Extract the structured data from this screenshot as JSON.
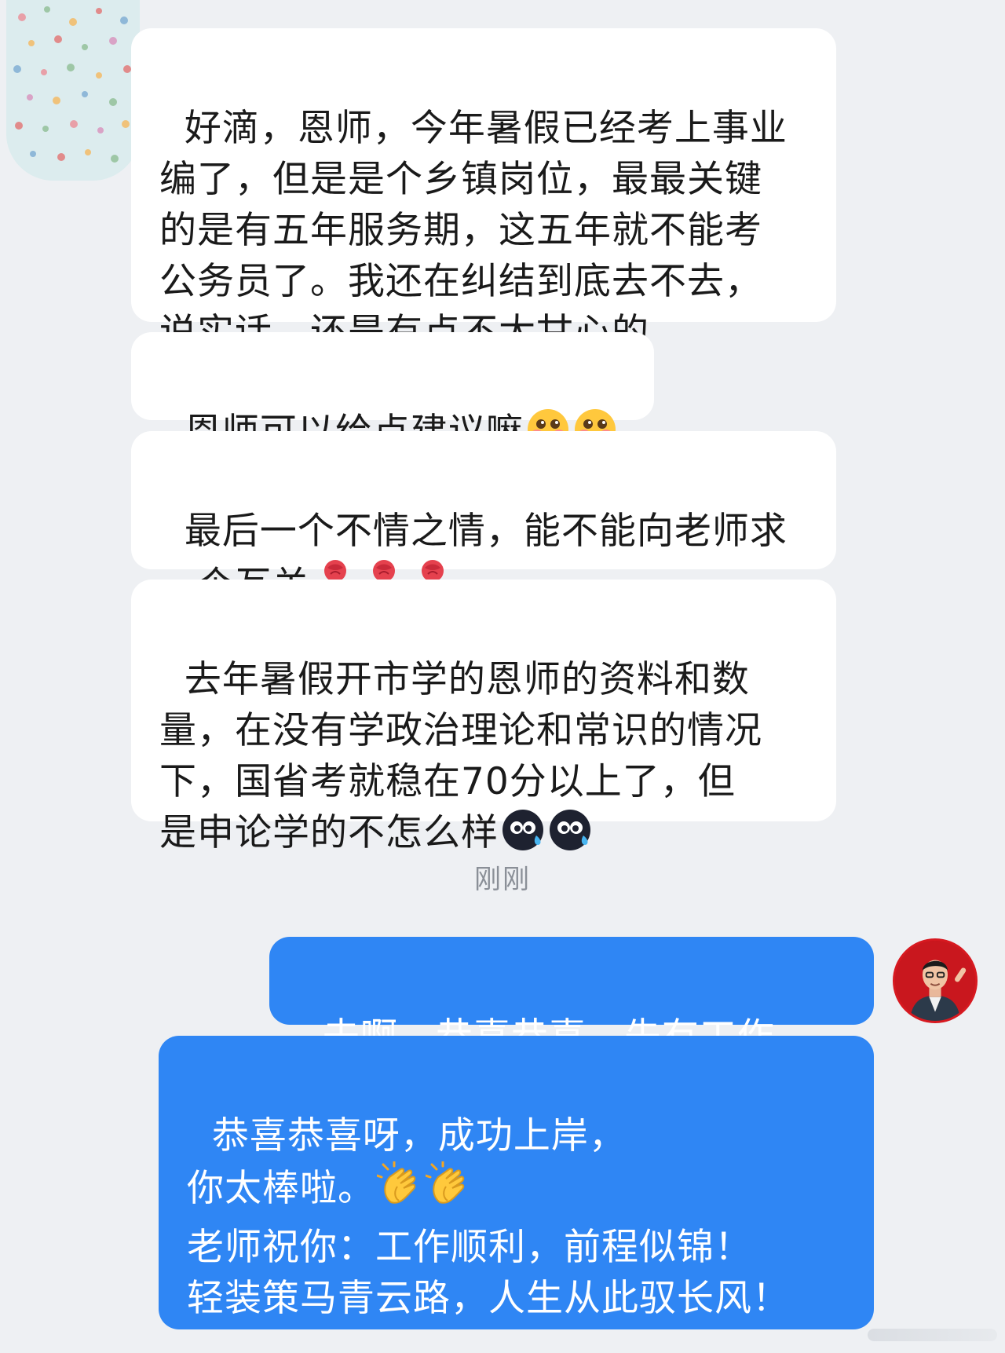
{
  "chat": {
    "incoming": [
      {
        "text": "好滴，恩师，今年暑假已经考上事业\n编了，但是是个乡镇岗位，最最关键\n的是有五年服务期，这五年就不能考\n公务员了。我还在纠结到底去不去，\n说实话，还是有点不太甘心的",
        "emojis": []
      },
      {
        "text": "恩师可以给点建议嘛",
        "emojis": [
          "blushing-heart-emoji",
          "blushing-heart-emoji"
        ]
      },
      {
        "text": "最后一个不情之情，能不能向老师求\n一个互关",
        "emojis": [
          "rose-emoji",
          "rose-emoji",
          "rose-emoji"
        ]
      },
      {
        "text": "去年暑假开市学的恩师的资料和数\n量，在没有学政治理论和常识的情况\n下，国省考就稳在70分以上了，但\n是申论学的不怎么样",
        "emojis": [
          "sweat-face-emoji",
          "sweat-face-emoji"
        ]
      }
    ],
    "timestamp": "刚刚",
    "outgoing": [
      {
        "text": "去啊，恭喜恭喜，先有工作啊。"
      },
      {
        "text_line1": "恭喜恭喜呀，成功上岸，",
        "text_line2": "你太棒啦。",
        "emojis": [
          "clapping-hands-emoji",
          "clapping-hands-emoji"
        ],
        "text_rest": "\n老师祝你：工作顺利，前程似锦！\n轻装策马青云路，人生从此驭长风！"
      }
    ]
  },
  "colors": {
    "background": "#eef0f3",
    "incoming_bubble": "#ffffff",
    "outgoing_bubble": "#2f86f4",
    "timestamp_text": "#8a8f97"
  }
}
